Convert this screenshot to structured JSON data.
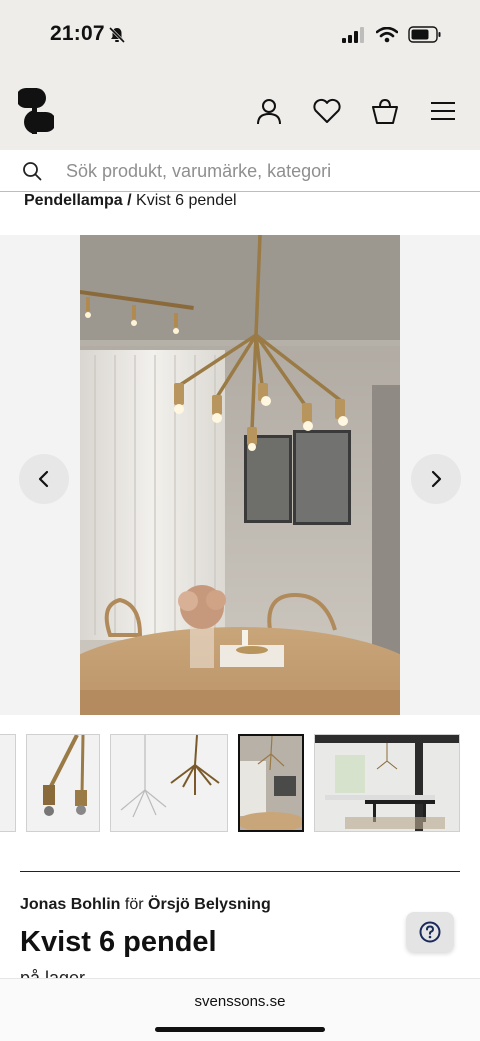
{
  "status_bar": {
    "time": "21:07"
  },
  "header": {
    "logo": "svenssons-logo",
    "icons": [
      "user-icon",
      "heart-icon",
      "basket-icon",
      "menu-icon"
    ]
  },
  "search": {
    "placeholder": "Sök produkt, varumärke, kategori"
  },
  "breadcrumb": {
    "parent": "Pendellampa",
    "separator": " / ",
    "current": "Kvist 6 pendel"
  },
  "gallery": {
    "prev_icon": "chevron-left-icon",
    "next_icon": "chevron-right-icon"
  },
  "product": {
    "designer": "Jonas Bohlin",
    "for": "för",
    "manufacturer": "Örsjö Belysning",
    "title": "Kvist 6 pendel",
    "partial_text": "på lager"
  },
  "help": {
    "icon": "question-icon"
  },
  "browser": {
    "domain": "svenssons.se"
  },
  "colors": {
    "header_bg": "#eeedea",
    "search_border": "#c9b9b4",
    "text": "#111111"
  }
}
